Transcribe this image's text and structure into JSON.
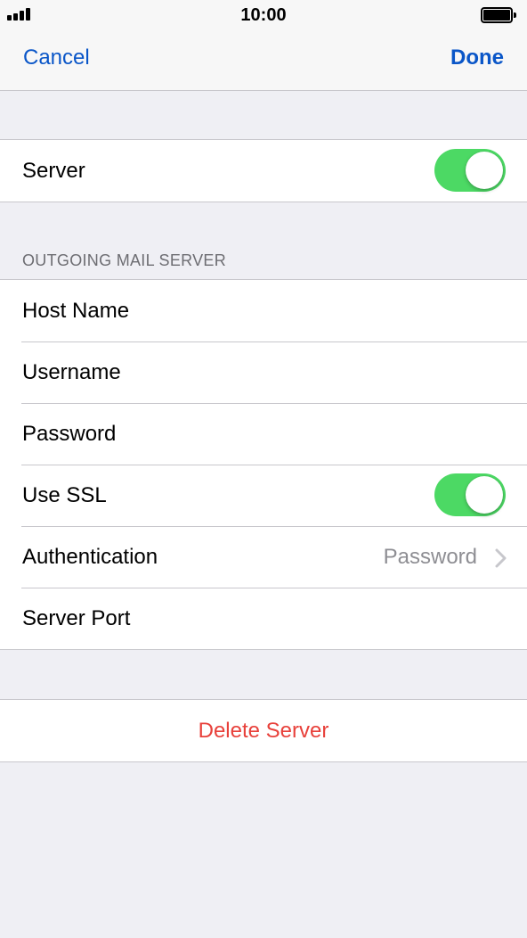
{
  "status_bar": {
    "time": "10:00",
    "signal_icon": "signal-bars-icon",
    "battery_icon": "battery-full-icon"
  },
  "nav": {
    "cancel_label": "Cancel",
    "done_label": "Done"
  },
  "server_group": {
    "label": "Server",
    "enabled": true
  },
  "outgoing": {
    "header": "OUTGOING MAIL SERVER",
    "host_name_label": "Host Name",
    "username_label": "Username",
    "password_label": "Password",
    "use_ssl_label": "Use SSL",
    "use_ssl_enabled": true,
    "authentication_label": "Authentication",
    "authentication_value": "Password",
    "server_port_label": "Server Port"
  },
  "delete_label": "Delete Server",
  "colors": {
    "accent": "#0a56c8",
    "toggle_on": "#4cd964",
    "destructive": "#e8413b"
  }
}
